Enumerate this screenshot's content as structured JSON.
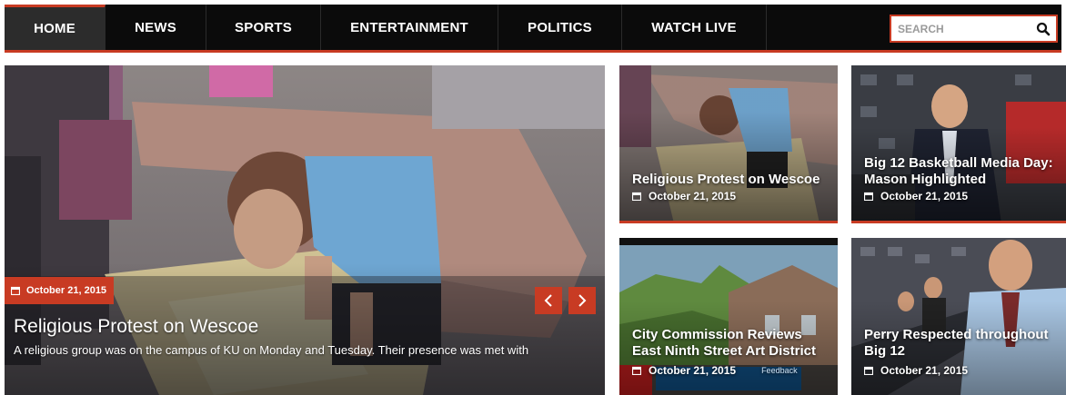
{
  "nav": {
    "items": [
      {
        "label": "HOME"
      },
      {
        "label": "NEWS"
      },
      {
        "label": "SPORTS"
      },
      {
        "label": "ENTERTAINMENT"
      },
      {
        "label": "POLITICS"
      },
      {
        "label": "WATCH LIVE"
      }
    ],
    "active": "HOME",
    "search_placeholder": "SEARCH"
  },
  "hero": {
    "date": "October 21, 2015",
    "title": "Religious Protest on Wescoe",
    "excerpt": "A religious group was on the campus of KU on Monday and Tuesday. Their presence was met with",
    "prev_icon": "chevron-left-icon",
    "next_icon": "chevron-right-icon"
  },
  "cards": [
    {
      "title_lines": [
        "Religious Protest on Wescoe"
      ],
      "date": "October 21, 2015"
    },
    {
      "title_lines": [
        "Big 12 Basketball Media Day:",
        "Mason Highlighted"
      ],
      "date": "October 21, 2015"
    },
    {
      "title_lines": [
        "City Commission Reviews",
        "East Ninth Street Art District"
      ],
      "date": "October 21, 2015",
      "ticker": "Feedback"
    },
    {
      "title_lines": [
        "Perry Respected throughout",
        "Big 12"
      ],
      "date": "October 21, 2015"
    }
  ],
  "colors": {
    "accent": "#c83b23",
    "nav_bg": "#0b0b0b",
    "nav_active_bg": "#2c2c2c"
  }
}
